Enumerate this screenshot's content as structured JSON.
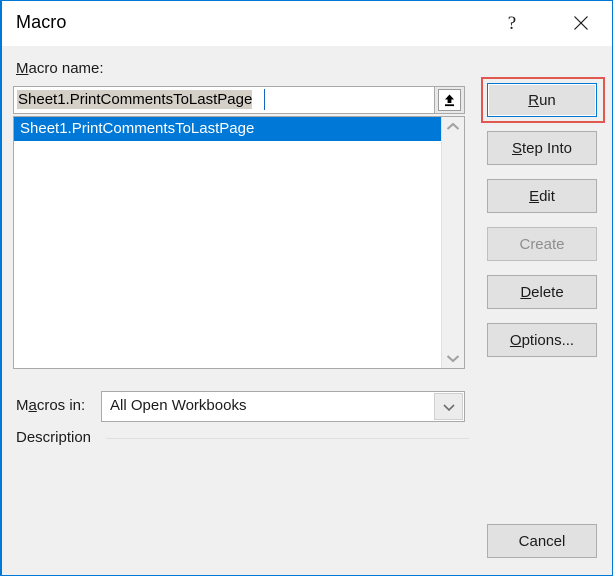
{
  "window": {
    "title": "Macro",
    "help_icon": "question-mark-icon",
    "close_icon": "close-icon",
    "accent_color": "#0078d7",
    "body_color": "#f0f0f0"
  },
  "form": {
    "macro_name_label_pre": "M",
    "macro_name_label_post": "acro name:",
    "macro_name_value": "Sheet1.PrintCommentsToLastPage",
    "macro_name_placeholder": "",
    "upload_icon": "up-arrow-icon"
  },
  "list": {
    "items": [
      {
        "label": "Sheet1.PrintCommentsToLastPage",
        "selected": true
      }
    ],
    "scroll_up_icon": "chevron-up-icon",
    "scroll_down_icon": "chevron-down-icon",
    "selection_color": "#0078d7"
  },
  "macros_in": {
    "label_pre": "M",
    "label_mid": "a",
    "label_post": "cros in:",
    "selected_value": "All Open Workbooks",
    "dropdown_icon": "chevron-down-icon"
  },
  "description": {
    "label": "Description",
    "text": ""
  },
  "buttons": {
    "run": {
      "pre": "R",
      "accel": "",
      "post": "un",
      "full": "Run",
      "disabled": false,
      "focused": true
    },
    "step_into": {
      "pre": "S",
      "post": "tep Into",
      "full": "Step Into",
      "disabled": false,
      "focused": false
    },
    "edit": {
      "pre": "E",
      "post": "dit",
      "full": "Edit",
      "disabled": false,
      "focused": false
    },
    "create": {
      "pre": "",
      "post": "Create",
      "full": "Create",
      "disabled": true,
      "focused": false
    },
    "delete": {
      "pre": "D",
      "post": "elete",
      "full": "Delete",
      "disabled": false,
      "focused": false
    },
    "options": {
      "pre": "O",
      "post": "ptions...",
      "full": "Options...",
      "disabled": false,
      "focused": false
    },
    "cancel": {
      "pre": "",
      "post": "Cancel",
      "full": "Cancel",
      "disabled": false,
      "focused": false
    }
  },
  "annotation": {
    "target": "run-button",
    "color": "#e0584f"
  }
}
